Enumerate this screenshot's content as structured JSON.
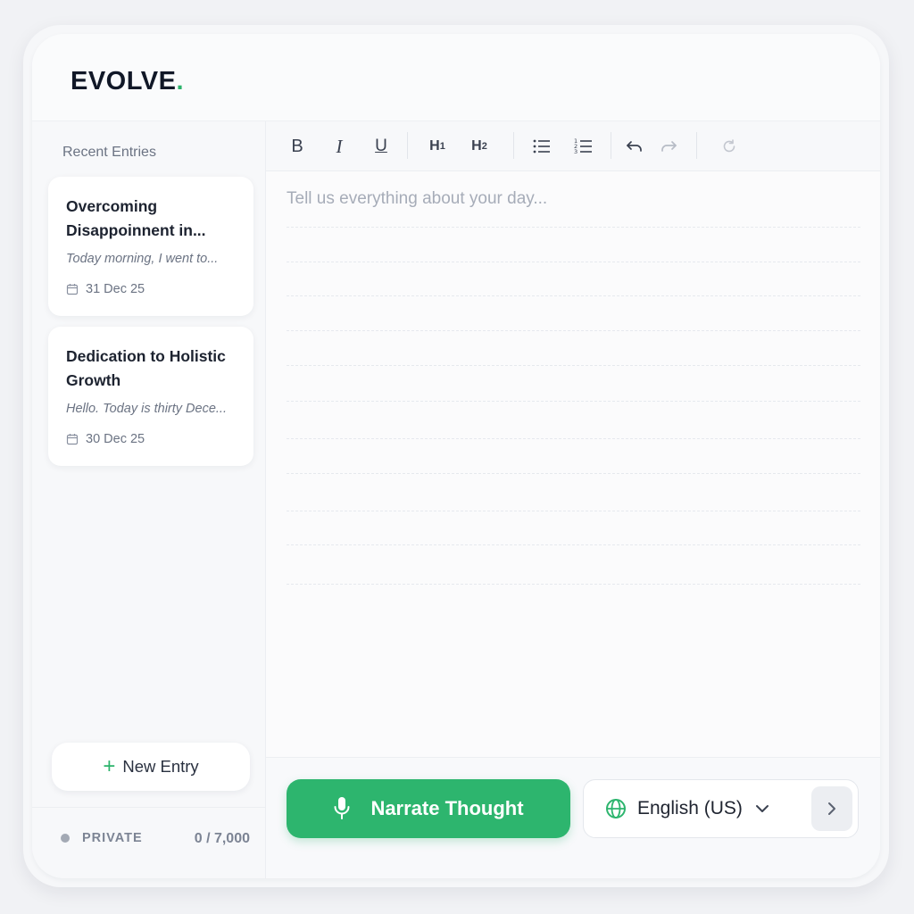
{
  "brand": {
    "name": "EVOLVE",
    "dot": "."
  },
  "sidebar": {
    "section_title": "Recent Entries",
    "entries": [
      {
        "title": "Overcoming Disappoinnent in...",
        "excerpt": "Today morning, I went to...",
        "date": "31 Dec 25"
      },
      {
        "title": "Dedication to Holistic Growth",
        "excerpt": "Hello. Today is thirty Dece...",
        "date": "30 Dec 25"
      }
    ],
    "new_entry_label": "New Entry",
    "privacy_label": "PRIVATE",
    "char_count": "0 / 7,000"
  },
  "toolbar": {
    "bold": "B",
    "italic": "I",
    "underline": "U",
    "h1": "H",
    "h1_sub": "1",
    "h2": "H",
    "h2_sub": "2"
  },
  "editor": {
    "placeholder": "Tell us everything about your day..."
  },
  "footer": {
    "narrate_label": "Narrate Thought",
    "language": "English (US)"
  },
  "colors": {
    "accent": "#2db56e",
    "background": "#f1f2f5",
    "text": "#1f2430"
  },
  "icons": [
    "calendar-icon",
    "plus-icon",
    "mic-icon",
    "globe-icon",
    "chevron-down-icon",
    "chevron-right-icon",
    "bullet-list-icon",
    "numbered-list-icon",
    "undo-icon",
    "redo-icon",
    "refresh-icon"
  ]
}
